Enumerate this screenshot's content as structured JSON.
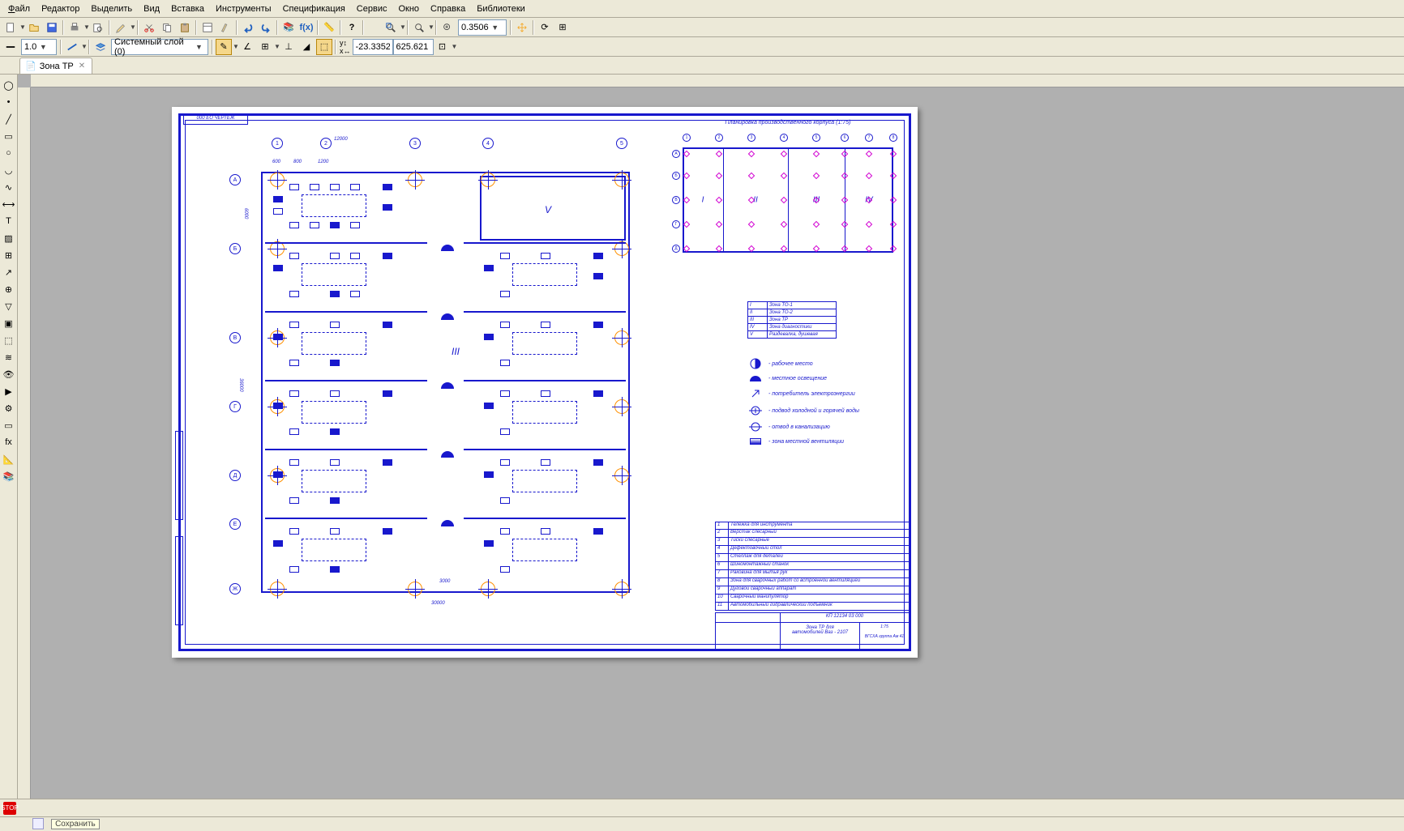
{
  "menubar": [
    "Файл",
    "Редактор",
    "Выделить",
    "Вид",
    "Вставка",
    "Инструменты",
    "Спецификация",
    "Сервис",
    "Окно",
    "Справка",
    "Библиотеки"
  ],
  "toolbar1": {
    "scale_combo": "0.3506"
  },
  "toolbar2": {
    "zoom_combo": "1.0",
    "layer": "Системный слой (0)",
    "coord_x": "-23.3352",
    "coord_y": "625.621"
  },
  "tab": {
    "title": "Зона ТР"
  },
  "drawing": {
    "stamp": "000 ЕО ЧЕРТЕЖ",
    "miniplan_title": "Планировка производственного  корпуса (1:75)",
    "roman_main": [
      "III",
      "V"
    ],
    "roman_mini": [
      "I",
      "II",
      "III",
      "IV"
    ],
    "axis_top": [
      "1",
      "2",
      "3",
      "4",
      "5"
    ],
    "axis_left": [
      "А",
      "Б",
      "В",
      "Г",
      "Д",
      "Е",
      "Ж"
    ],
    "mini_axis_top": [
      "1",
      "2",
      "3",
      "4",
      "5",
      "6",
      "7",
      "8"
    ],
    "mini_axis_left": [
      "А",
      "Б",
      "В",
      "Г",
      "Д"
    ],
    "dims": {
      "top_span": "12000",
      "w_600": "600",
      "w_800": "800",
      "w_1200": "1200",
      "h_6000": "6000",
      "h_36000": "36000",
      "w_3000": "3000",
      "w_30000": "30000"
    },
    "zone_table": [
      {
        "n": "I",
        "t": "Зона ТО-1"
      },
      {
        "n": "II",
        "t": "Зона ТО-2"
      },
      {
        "n": "III",
        "t": "Зона ТР"
      },
      {
        "n": "IV",
        "t": "Зона диагностики"
      },
      {
        "n": "V",
        "t": "Раздевалка, душевая"
      }
    ],
    "legend": [
      "- рабочее место",
      "- местное освещение",
      "- потребитель электроэнергии",
      "- подвод холодной и горячей воды",
      "- отвод в канализацию",
      "- зона местной вентиляции"
    ],
    "spec": [
      {
        "n": "1",
        "t": "Тележка для инструмента"
      },
      {
        "n": "2",
        "t": "Верстак слесарный"
      },
      {
        "n": "3",
        "t": "Тиски слесарные"
      },
      {
        "n": "4",
        "t": "Дефектовочный стол"
      },
      {
        "n": "5",
        "t": "Стеллаж для деталей"
      },
      {
        "n": "6",
        "t": "Шиномонтажный станок"
      },
      {
        "n": "7",
        "t": "Раковина для мытья рук"
      },
      {
        "n": "8",
        "t": "Зона для сварочных работ со встроенной вентиляцией"
      },
      {
        "n": "9",
        "t": "Дуговой сварочный аппарат"
      },
      {
        "n": "10",
        "t": "Сварочный манипулятор"
      },
      {
        "n": "11",
        "t": "Автомобильный гидравлический подъемник"
      }
    ],
    "titleblock": {
      "code": "КП 12134 03 000",
      "title1": "Зона ТР для",
      "title2": "автомобилей Ваз - 2107",
      "scale": "1:75",
      "org": "ВГСХА\nгруппа Ам 41"
    }
  },
  "status_hint": "Сохранить"
}
